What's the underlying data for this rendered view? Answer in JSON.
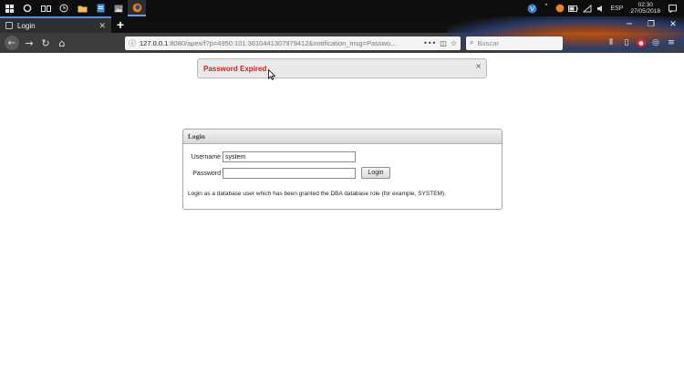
{
  "taskbar": {
    "date_time": {
      "time": "02:30",
      "date": "27/05/2018"
    },
    "tray_keyboard_label": "ESP"
  },
  "browser": {
    "tab": {
      "title": "Login"
    },
    "newtab_label": "+",
    "url": {
      "host": "127.0.0.1",
      "rest": ":8080/apex/f?p=4950:101:3610441307979412&notification_msg=Passwo..."
    },
    "search": {
      "placeholder": "Buscar"
    }
  },
  "page": {
    "notification": {
      "message": "Password Expired",
      "close_label": "×"
    },
    "login": {
      "title": "Login",
      "username_label": "Username",
      "username_value": "system",
      "password_label": "Password",
      "password_value": "",
      "button_label": "Login",
      "help_text": "Login as a database user which has been granted the DBA database role (for example, SYSTEM)."
    }
  },
  "colors": {
    "notification_text": "#cc1f1f",
    "tab_accent": "#4d90f0",
    "taskbar_bg": "#0d0d0d"
  }
}
